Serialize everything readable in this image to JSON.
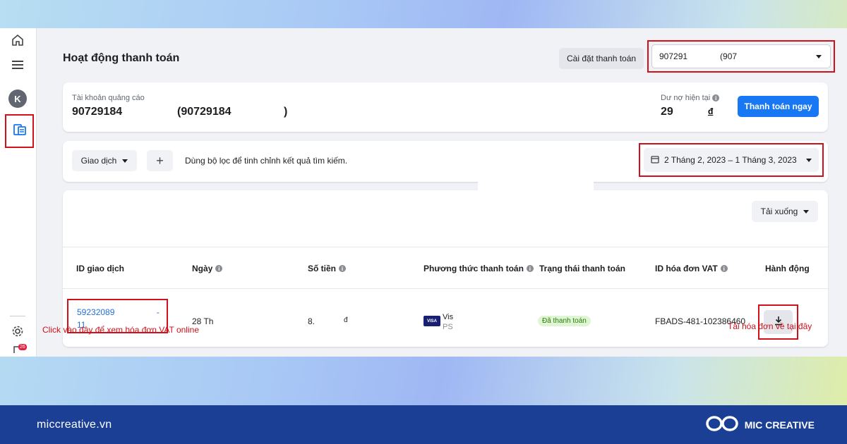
{
  "page": {
    "title": "Hoạt động thanh toán",
    "settings_button": "Cài đặt thanh toán",
    "account_select": {
      "id": "907291",
      "name": "(907"
    }
  },
  "account": {
    "label": "Tài khoản quảng cáo",
    "id": "90729184",
    "name_open": "(90729184",
    "name_close": ")",
    "balance_label": "Dư nợ hiện tại",
    "balance_value": "29",
    "balance_currency": "đ",
    "pay_button": "Thanh toán ngay"
  },
  "filter": {
    "transaction_label": "Giao dịch",
    "add_symbol": "+",
    "hint": "Dùng bộ lọc để tinh chỉnh kết quả tìm kiếm.",
    "date_range": "2 Tháng 2, 2023 – 1 Tháng 3, 2023"
  },
  "table": {
    "download_label": "Tải xuống",
    "headers": [
      "ID giao dịch",
      "Ngày",
      "Số tiền",
      "Phương thức thanh toán",
      "Trạng thái thanh toán",
      "ID hóa đơn VAT",
      "Hành động"
    ],
    "row": {
      "id_line1": "59232089",
      "id_dash": "-",
      "id_line2": "11",
      "date": "28 Th",
      "amount": "8.",
      "amount_tail": "đ",
      "method_brand": "VISA",
      "method_line1": "Vis",
      "method_line2": "PS",
      "status": "Đã thanh toán",
      "vat_id": "FBADS-481-102386460"
    }
  },
  "notes": {
    "left": "Click vào đây để xem hóa đơn VAT online",
    "right": "Tải hóa đơn về tại đây"
  },
  "sidebar": {
    "avatar_letter": "K",
    "notification_count": "26"
  },
  "footer": {
    "url": "miccreative.vn",
    "brand": "MIC CREATIVE"
  },
  "colors": {
    "highlight": "#d0101a",
    "primary": "#1877f2",
    "footer": "#1b3f95"
  }
}
